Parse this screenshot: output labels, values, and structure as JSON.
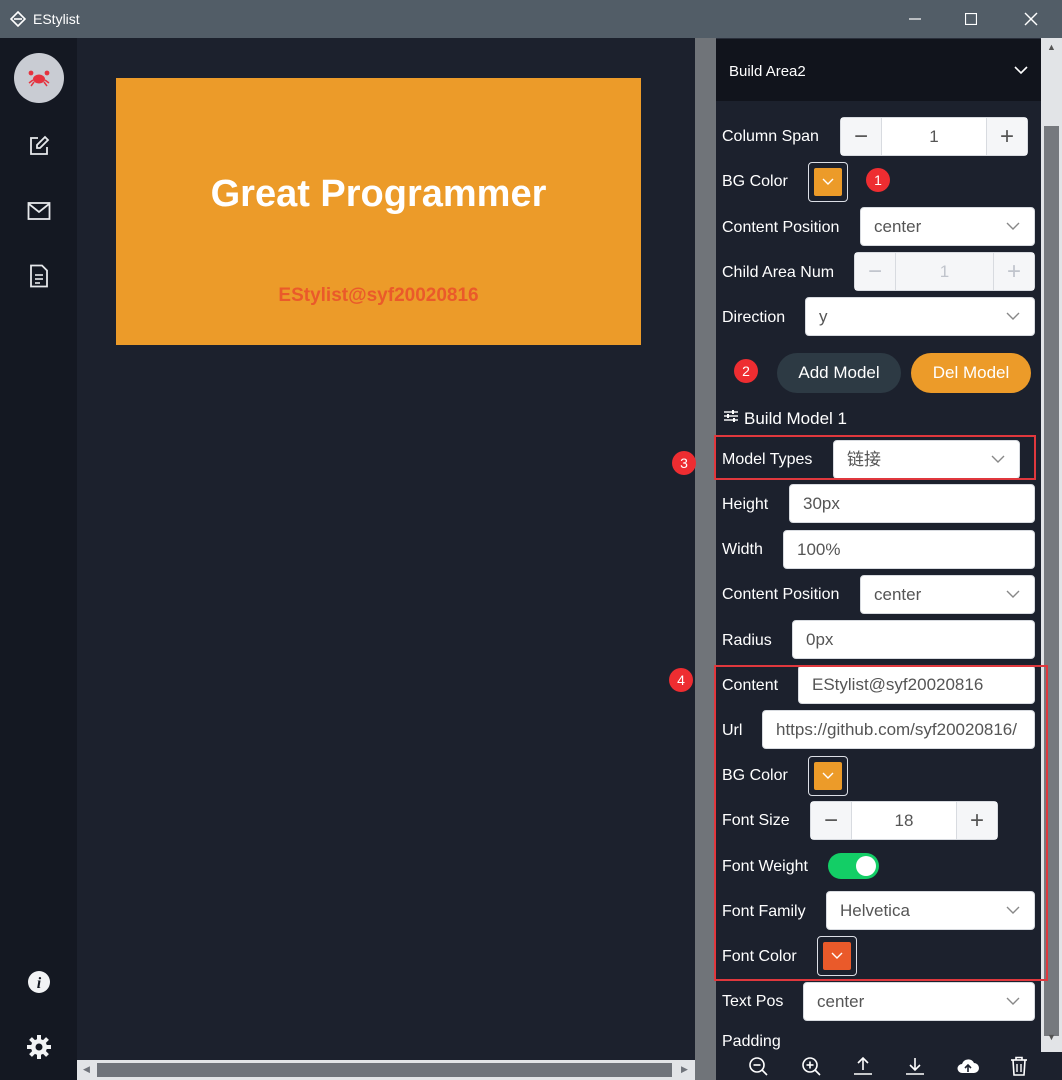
{
  "window": {
    "title": "EStylist"
  },
  "canvas": {
    "card_title": "Great Programmer",
    "card_link": "EStylist@syf20020816",
    "card_bg": "#ec9b29",
    "link_color": "#ea5a2a"
  },
  "panel": {
    "header": "Build Area2",
    "column_span": {
      "label": "Column Span",
      "value": "1"
    },
    "bg_color": {
      "label": "BG Color",
      "value": "#ec9b29"
    },
    "content_position": {
      "label": "Content Position",
      "value": "center"
    },
    "child_area_num": {
      "label": "Child Area Num",
      "value": "1"
    },
    "direction": {
      "label": "Direction",
      "value": "y"
    },
    "add_model": "Add Model",
    "del_model": "Del Model",
    "build_model": "Build Model 1",
    "model_types": {
      "label": "Model Types",
      "value": "链接"
    },
    "height": {
      "label": "Height",
      "value": "30px"
    },
    "width": {
      "label": "Width",
      "value": "100%"
    },
    "content_position2": {
      "label": "Content Position",
      "value": "center"
    },
    "radius": {
      "label": "Radius",
      "value": "0px"
    },
    "content": {
      "label": "Content",
      "value": "EStylist@syf20020816"
    },
    "url": {
      "label": "Url",
      "value": "https://github.com/syf20020816/"
    },
    "bg_color2": {
      "label": "BG Color",
      "value": "#ec9b29"
    },
    "font_size": {
      "label": "Font Size",
      "value": "18"
    },
    "font_weight": {
      "label": "Font Weight",
      "on": true
    },
    "font_family": {
      "label": "Font Family",
      "value": "Helvetica"
    },
    "font_color": {
      "label": "Font Color",
      "value": "#ea5a2a"
    },
    "text_pos": {
      "label": "Text Pos",
      "value": "center"
    },
    "padding": {
      "label": "Padding"
    }
  },
  "annotations": [
    "1",
    "2",
    "3",
    "4"
  ],
  "colors": {
    "accent_orange": "#ec9b29",
    "dark_button": "#2d3a44",
    "toggle_on": "#13ce66",
    "annotation_red": "#ee2d31"
  }
}
